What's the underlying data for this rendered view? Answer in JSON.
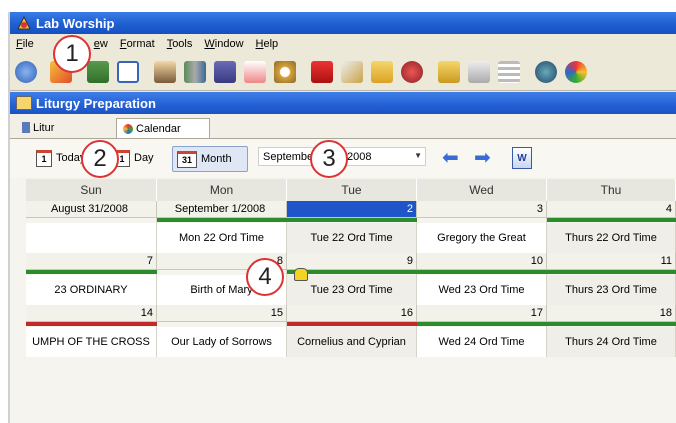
{
  "app": {
    "title": "Lab  Worship"
  },
  "menu": [
    "File",
    "ew",
    "Format",
    "Tools",
    "Window",
    "Help"
  ],
  "child_window": {
    "title": "Liturgy Preparation"
  },
  "tabs": [
    {
      "label": "Litur"
    },
    {
      "label": "Calendar"
    }
  ],
  "controls": {
    "today": "Today",
    "today_icon_num": "1",
    "day": "Day",
    "day_icon_num": "1",
    "month": "Month",
    "month_icon_num": "31",
    "month_select": "September",
    "year_select": "2008"
  },
  "days": [
    "Sun",
    "Mon",
    "Tue",
    "Wed",
    "Thu"
  ],
  "weeks": [
    {
      "nums": [
        "August 31/2008",
        "September 1/2008",
        "2",
        "3",
        "4"
      ],
      "bars": [
        "",
        "#2a8c2a",
        "#2a8c2a",
        "",
        "#2a8c2a"
      ],
      "labels": [
        "",
        "Mon 22 Ord Time",
        "Tue 22 Ord Time",
        "Gregory the Great",
        "Thurs 22 Ord Time"
      ]
    },
    {
      "nums": [
        "7",
        "8",
        "9",
        "10",
        "11"
      ],
      "bars": [
        "#2a8c2a",
        "",
        "#2a8c2a",
        "#2a8c2a",
        "#2a8c2a"
      ],
      "labels": [
        "23 ORDINARY",
        "Birth of Mary",
        "Tue 23 Ord Time",
        "Wed 23 Ord Time",
        "Thurs 23 Ord Time"
      ]
    },
    {
      "nums": [
        "14",
        "15",
        "16",
        "17",
        "18"
      ],
      "bars": [
        "#c02a2a",
        "",
        "#c02a2a",
        "#2a8c2a",
        "#2a8c2a"
      ],
      "labels": [
        "UMPH OF THE CROSS",
        "Our Lady of Sorrows",
        "Cornelius and Cyprian",
        "Wed 24 Ord Time",
        "Thurs 24 Ord Time"
      ]
    }
  ],
  "callouts": [
    "1",
    "2",
    "3",
    "4"
  ],
  "colors": {
    "ordinary_green": "#2a8c2a",
    "feast_red": "#c02a2a",
    "selection_blue": "#1f55c8"
  }
}
